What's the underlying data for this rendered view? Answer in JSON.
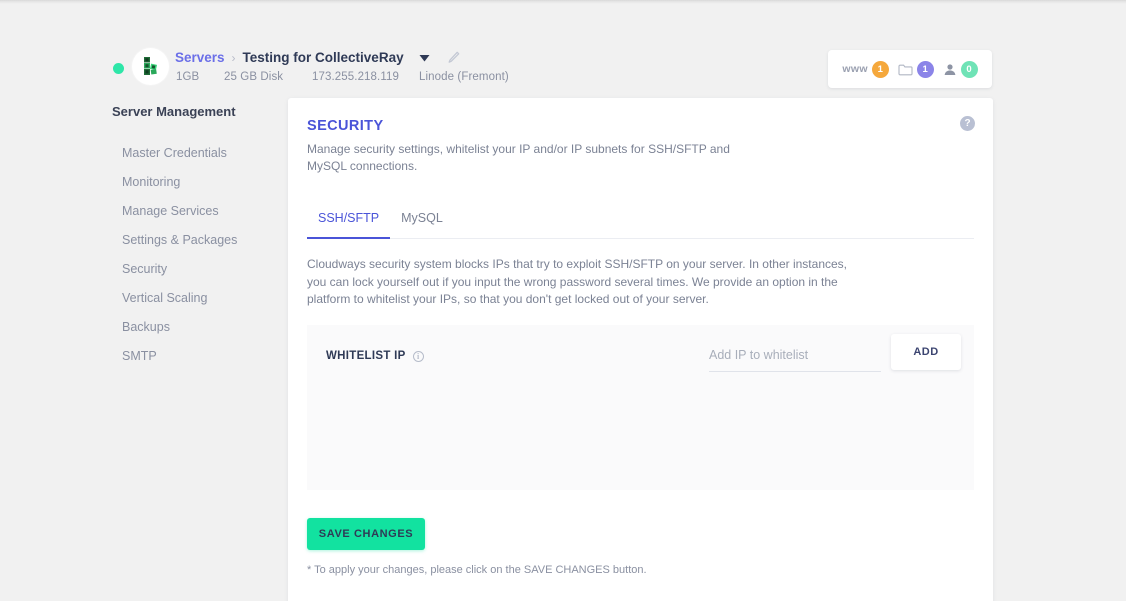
{
  "topbar": {
    "status": "online",
    "breadcrumb": {
      "parent": "Servers",
      "separator": "›",
      "current": "Testing for CollectiveRay",
      "caret_icon": "chevron-down-icon",
      "edit_icon": "pencil-icon"
    },
    "specs": {
      "ram": "1GB",
      "disk": "25 GB Disk",
      "ip": "173.255.218.119",
      "provider": "Linode (Fremont)"
    },
    "badges": [
      {
        "label": "www",
        "icon": "www-icon",
        "count": "1",
        "color": "#f5a83c"
      },
      {
        "label": "",
        "icon": "folder-icon",
        "count": "1",
        "color": "#8b84e8"
      },
      {
        "label": "",
        "icon": "user-icon",
        "count": "0",
        "color": "#6fe3b6"
      }
    ]
  },
  "sidebar": {
    "title": "Server Management",
    "items": [
      {
        "label": "Master Credentials"
      },
      {
        "label": "Monitoring"
      },
      {
        "label": "Manage Services"
      },
      {
        "label": "Settings & Packages"
      },
      {
        "label": "Security"
      },
      {
        "label": "Vertical Scaling"
      },
      {
        "label": "Backups"
      },
      {
        "label": "SMTP"
      }
    ]
  },
  "main": {
    "title": "SECURITY",
    "subtitle": "Manage security settings, whitelist your IP and/or IP subnets for SSH/SFTP and MySQL connections.",
    "help_icon_label": "?",
    "tabs": [
      {
        "label": "SSH/SFTP",
        "active": true
      },
      {
        "label": "MySQL",
        "active": false
      }
    ],
    "body_text": "Cloudways security system blocks IPs that try to exploit SSH/SFTP on your server. In other instances, you can lock yourself out if you input the wrong password several times. We provide an option in the platform to whitelist your IPs, so that you don't get locked out of your server.",
    "whitelist": {
      "label": "WHITELIST IP",
      "info_icon_label": "i",
      "input_value": "",
      "input_placeholder": "Add IP to whitelist",
      "add_button": "ADD"
    },
    "save_button": "SAVE CHANGES",
    "footnote": "* To apply your changes, please click on the SAVE CHANGES button.",
    "accent_color": "#4a54d8",
    "save_color": "#12e2a0"
  }
}
